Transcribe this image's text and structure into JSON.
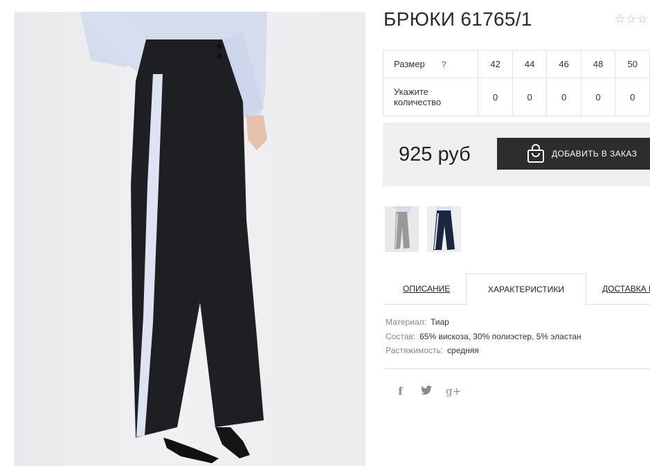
{
  "product": {
    "title": "БРЮКИ 61765/1",
    "rating_stars": 5,
    "rating_value": 0
  },
  "sizes": {
    "row_label": "Размер",
    "help_icon": "?",
    "qty_label": "Укажите количество",
    "columns": [
      "42",
      "44",
      "46",
      "48",
      "50"
    ],
    "quantities": [
      "0",
      "0",
      "0",
      "0",
      "0"
    ]
  },
  "price": {
    "value": "925 руб",
    "button_label": "ДОБАВИТЬ В ЗАКАЗ",
    "button_icon": "shopping-bag-icon"
  },
  "thumbnails": [
    {
      "alt": "black-trousers-thumbnail"
    },
    {
      "alt": "navy-trousers-thumbnail"
    }
  ],
  "tabs": [
    {
      "label": "ОПИСАНИЕ",
      "active": false
    },
    {
      "label": "ХАРАКТЕРИСТИКИ",
      "active": true
    },
    {
      "label": "ДОСТАВКА И",
      "active": false
    }
  ],
  "specs": [
    {
      "label": "Материал:",
      "value": "Тиар"
    },
    {
      "label": "Состав:",
      "value": "65% вискоза, 30% полиэстер, 5% эластан"
    },
    {
      "label": "Растяжимость:",
      "value": "средняя"
    }
  ],
  "social": [
    {
      "icon": "facebook-icon",
      "glyph": "f"
    },
    {
      "icon": "twitter-icon",
      "glyph": "t"
    },
    {
      "icon": "google-plus-icon",
      "glyph": "g+"
    }
  ],
  "colors": {
    "button_bg": "#2d2d2d",
    "price_box_bg": "#efefef",
    "star": "#b9b9b9"
  }
}
